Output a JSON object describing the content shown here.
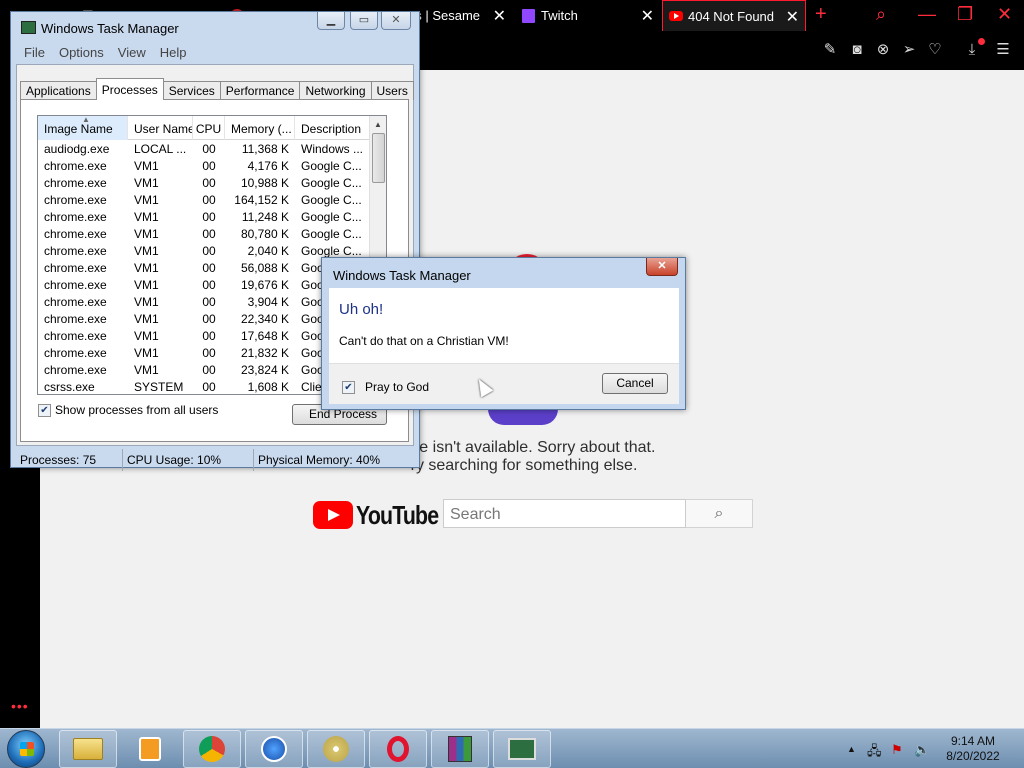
{
  "browser": {
    "tabs": [
      {
        "title": "es | Sesame",
        "icon": "sesame-favicon",
        "active": false
      },
      {
        "title": "Twitch",
        "icon": "twitch-icon",
        "active": false
      },
      {
        "title": "404 Not Found",
        "icon": "youtube-icon",
        "active": true
      }
    ],
    "new_tab_symbol": "+",
    "accent_color": "#ff1b2d"
  },
  "youtube_page": {
    "error_line1": "page isn't available. Sorry about that.",
    "error_line2": "ry searching for something else.",
    "logo_text": "YouTube",
    "search_placeholder": "Search"
  },
  "task_manager": {
    "title": "Windows Task Manager",
    "menu": [
      "File",
      "Options",
      "View",
      "Help"
    ],
    "tabs": [
      "Applications",
      "Processes",
      "Services",
      "Performance",
      "Networking",
      "Users"
    ],
    "selected_tab": "Processes",
    "columns": [
      "Image Name",
      "User Name",
      "CPU",
      "Memory (...",
      "Description"
    ],
    "processes": [
      {
        "name": "audiodg.exe",
        "user": "LOCAL ...",
        "cpu": "00",
        "memory": "11,368 K",
        "desc": "Windows ..."
      },
      {
        "name": "chrome.exe",
        "user": "VM1",
        "cpu": "00",
        "memory": "4,176 K",
        "desc": "Google C..."
      },
      {
        "name": "chrome.exe",
        "user": "VM1",
        "cpu": "00",
        "memory": "10,988 K",
        "desc": "Google C..."
      },
      {
        "name": "chrome.exe",
        "user": "VM1",
        "cpu": "00",
        "memory": "164,152 K",
        "desc": "Google C..."
      },
      {
        "name": "chrome.exe",
        "user": "VM1",
        "cpu": "00",
        "memory": "11,248 K",
        "desc": "Google C..."
      },
      {
        "name": "chrome.exe",
        "user": "VM1",
        "cpu": "00",
        "memory": "80,780 K",
        "desc": "Google C..."
      },
      {
        "name": "chrome.exe",
        "user": "VM1",
        "cpu": "00",
        "memory": "2,040 K",
        "desc": "Google C..."
      },
      {
        "name": "chrome.exe",
        "user": "VM1",
        "cpu": "00",
        "memory": "56,088 K",
        "desc": "Google C..."
      },
      {
        "name": "chrome.exe",
        "user": "VM1",
        "cpu": "00",
        "memory": "19,676 K",
        "desc": "Goo"
      },
      {
        "name": "chrome.exe",
        "user": "VM1",
        "cpu": "00",
        "memory": "3,904 K",
        "desc": "Goo"
      },
      {
        "name": "chrome.exe",
        "user": "VM1",
        "cpu": "00",
        "memory": "22,340 K",
        "desc": "Goo"
      },
      {
        "name": "chrome.exe",
        "user": "VM1",
        "cpu": "00",
        "memory": "17,648 K",
        "desc": "Goo"
      },
      {
        "name": "chrome.exe",
        "user": "VM1",
        "cpu": "00",
        "memory": "21,832 K",
        "desc": "Goo"
      },
      {
        "name": "chrome.exe",
        "user": "VM1",
        "cpu": "00",
        "memory": "23,824 K",
        "desc": "Goo"
      },
      {
        "name": "csrss.exe",
        "user": "SYSTEM",
        "cpu": "00",
        "memory": "1,608 K",
        "desc": "Clie"
      }
    ],
    "show_all_users_label": "Show processes from all users",
    "show_all_users_checked": true,
    "end_process_label": "End Process",
    "status": {
      "processes": "Processes: 75",
      "cpu": "CPU Usage: 10%",
      "memory": "Physical Memory: 40%"
    }
  },
  "dialog": {
    "title": "Windows Task Manager",
    "heading": "Uh oh!",
    "message": "Can't do that on a Christian VM!",
    "checkbox_label": "Pray to God",
    "checkbox_checked": true,
    "cancel_label": "Cancel"
  },
  "taskbar": {
    "apps": [
      "explorer-icon",
      "media-player-icon",
      "chrome-icon",
      "aimp-icon",
      "dvd-icon",
      "opera-icon",
      "winrar-icon",
      "task-manager-icon"
    ],
    "time": "9:14 AM",
    "date": "8/20/2022"
  }
}
